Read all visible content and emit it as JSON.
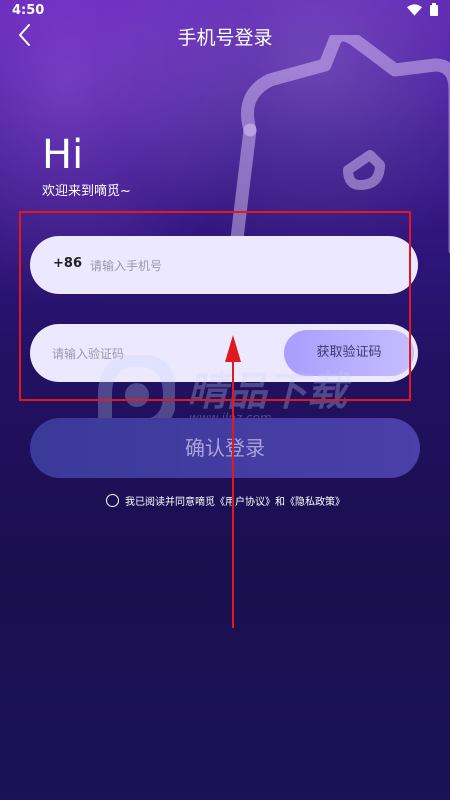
{
  "status_bar": {
    "time": "4:50",
    "icons": [
      "wifi-icon",
      "battery-icon"
    ]
  },
  "header": {
    "back_icon": "chevron-left-icon",
    "title": "手机号登录"
  },
  "greeting": {
    "hi": "Hi",
    "welcome": "欢迎来到嘀觅~"
  },
  "phone": {
    "country_code": "+86",
    "placeholder": "请输入手机号",
    "value": ""
  },
  "code": {
    "placeholder": "请输入验证码",
    "value": "",
    "get_code_label": "获取验证码"
  },
  "confirm": {
    "label": "确认登录"
  },
  "agreement": {
    "checked": false,
    "prefix": "我已阅读并同意嘀觅",
    "user_agreement": "《用户协议》",
    "conjunction": "和",
    "privacy_policy": "《隐私政策》"
  },
  "watermark": {
    "text": "晴品下载",
    "url": "www.jlpz.com"
  },
  "colors": {
    "annotation_red": "#e0191e",
    "input_bg": "#ece8ff",
    "get_code_bg": "#b6aaff",
    "confirm_bg": "#3f3aa0"
  }
}
